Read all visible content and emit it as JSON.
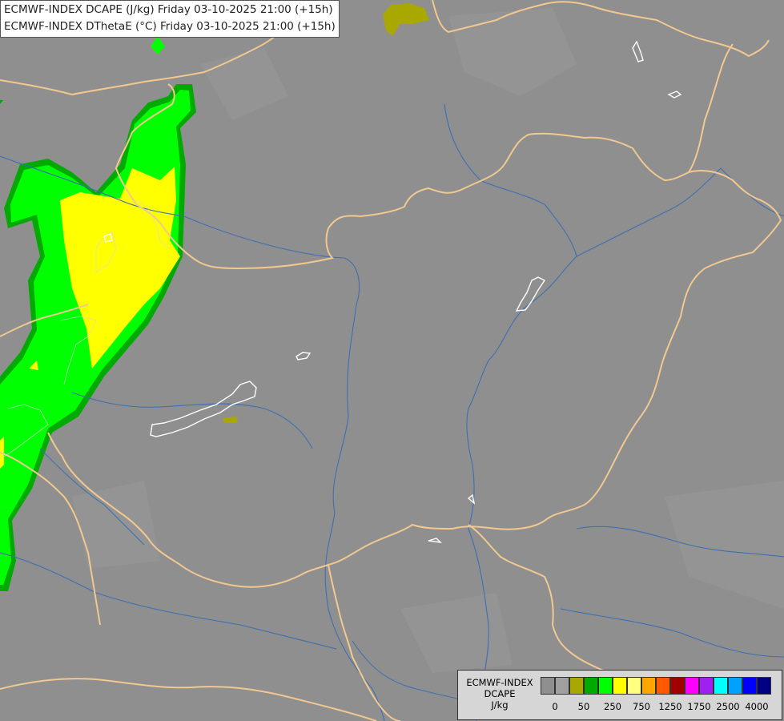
{
  "titles": [
    "ECMWF-INDEX DCAPE (J/kg) Friday 03-10-2025 21:00 (+15h)",
    "ECMWF-INDEX DThetaE (°C) Friday 03-10-2025 21:00 (+15h)"
  ],
  "legend": {
    "title_lines": [
      "ECMWF-INDEX",
      "DCAPE",
      "J/kg"
    ],
    "colors": [
      "#8f8f8f",
      "#a0a0a0",
      "#a8a800",
      "#00aa00",
      "#00ff00",
      "#ffff00",
      "#ffff80",
      "#ffa500",
      "#ff5a00",
      "#a00000",
      "#ff00ff",
      "#a020f0",
      "#00ffff",
      "#00a0ff",
      "#0000ff",
      "#000080"
    ],
    "tick_labels": [
      "0",
      "50",
      "250",
      "750",
      "1250",
      "1750",
      "2500",
      "4000"
    ]
  },
  "map": {
    "background_color": "#8f8f8f",
    "border_color": "#f0c890",
    "river_color": "#3f6fb0",
    "lake_color": "#ffffff"
  }
}
